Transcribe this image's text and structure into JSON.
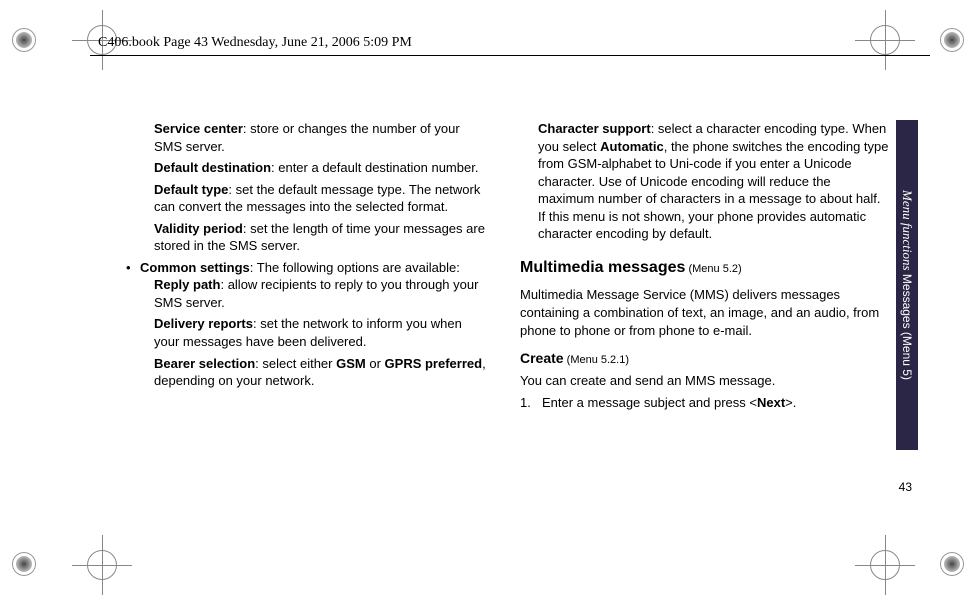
{
  "header": "C406.book  Page 43  Wednesday, June 21, 2006  5:09 PM",
  "page_number": "43",
  "side_tab": {
    "italic": "Menu functions",
    "plain": "    Messages  (Menu 5)"
  },
  "col1": {
    "p1_b": "Service center",
    "p1_t": ": store or changes the number of your SMS server.",
    "p2_b": "Default destination",
    "p2_t": ": enter a default destination number.",
    "p3_b": "Default type",
    "p3_t": ": set the default message type. The network can convert the messages into the selected format.",
    "p4_b": "Validity period",
    "p4_t": ": set the length of time your messages are stored in the SMS server.",
    "bullet": "•",
    "p5_b": "Common settings",
    "p5_t": ": The following options are available:",
    "p6_b": "Reply path",
    "p6_t": ": allow recipients to reply to you through your SMS server.",
    "p7_b": "Delivery reports",
    "p7_t": ": set the network to inform you when your messages have been delivered.",
    "p8_b": "Bearer selection",
    "p8_t1": ": select either ",
    "p8_b2": "GSM",
    "p8_t2": " or ",
    "p8_b3": "GPRS preferred",
    "p8_t3": ", depending on your network."
  },
  "col2": {
    "p1_b": "Character support",
    "p1_t1": ": select a character encoding type. When you select ",
    "p1_b2": "Automatic",
    "p1_t2": ", the phone switches the encoding type from GSM-alphabet to Uni-code if you enter a Unicode character. Use of Unicode encoding will reduce the maximum number of characters in a message to about half. If this menu is not shown, your phone provides automatic character encoding by default.",
    "h1": "Multimedia messages",
    "h1_m": " (Menu 5.2)",
    "p2": "Multimedia Message Service (MMS) delivers messages containing a combination of text, an image, and an audio, from phone to phone or from phone to e-mail.",
    "h2": "Create",
    "h2_m": " (Menu 5.2.1)",
    "p3": "You can create and send an MMS message.",
    "step_num": "1.",
    "step_t1": "Enter a message subject and press <",
    "step_b": "Next",
    "step_t2": ">."
  }
}
